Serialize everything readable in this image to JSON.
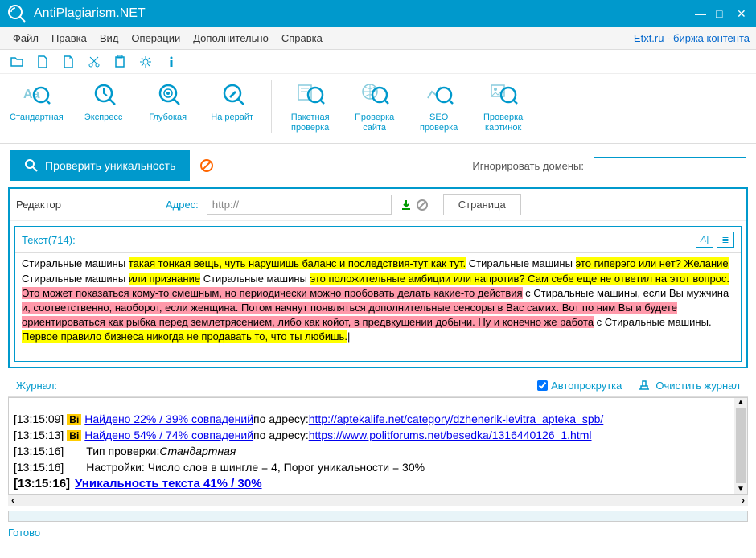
{
  "window": {
    "title": "AntiPlagiarism.NET"
  },
  "menu": {
    "file": "Файл",
    "edit": "Правка",
    "view": "Вид",
    "operations": "Операции",
    "additional": "Дополнительно",
    "help": "Справка",
    "etxt_link": "Etxt.ru - биржа контента"
  },
  "toolbar_big": {
    "standard": "Стандартная",
    "express": "Экспресс",
    "deep": "Глубокая",
    "rewrite": "На рерайт",
    "batch": "Пакетная\nпроверка",
    "site": "Проверка\nсайта",
    "seo": "SEO\nпроверка",
    "images": "Проверка\nкартинок"
  },
  "action": {
    "check_button": "Проверить уникальность",
    "ignore_label": "Игнорировать домены:",
    "ignore_value": ""
  },
  "editor": {
    "label": "Редактор",
    "address_label": "Адрес:",
    "address_value": "http://",
    "page_tab": "Страница",
    "text_count_label": "Текст(714):",
    "content_plain_1": "Стиральные машины ",
    "content_hl_1": "такая тонкая вещь, чуть нарушишь баланс и последствия-тут как тут.",
    "content_plain_2": " Стиральные машины ",
    "content_hl_2": "это гиперэго или нет? Желание",
    "content_plain_3": " Стиральные машины ",
    "content_hl_3": "или признание",
    "content_plain_4": " Стиральные машины ",
    "content_hl_4": "это положительные амбиции или напротив? Сам себе еще не ответил на этот вопрос.",
    "content_pink_1": " Это может показаться кому-то смешным, но периодически можно пробовать делать какие-то действия",
    "content_plain_5": " с Стиральные машины, если Вы мужчина ",
    "content_pink_2": "и, соответственно, наоборот, если женщина. Потом начнут появляться дополнительные сенсоры в Вас самих. Вот по ним Вы и будете ориентироваться как рыбка перед землетрясением, либо как койот, в предвкушении добычи. Ну и конечно же работа",
    "content_plain_6": " с Стиральные машины.",
    "content_hl_5": " Первое правило бизнеса никогда не продавать то, что ты любишь."
  },
  "journal": {
    "label": "Журнал:",
    "autoscroll": "Автопрокрутка",
    "clear": "Очистить журнал",
    "lines": [
      {
        "time": "[13:15:09]",
        "badge": "Bi",
        "link_text": "Найдено 22% / 39% совпадений",
        "mid": " по адресу: ",
        "url": "http://aptekalife.net/category/dzhenerik-levitra_apteka_spb/"
      },
      {
        "time": "[13:15:13]",
        "badge": "Bi",
        "link_text": "Найдено 54% / 74% совпадений",
        "mid": " по адресу: ",
        "url": "https://www.politforums.net/besedka/1316440126_1.html"
      },
      {
        "time": "[13:15:16]",
        "text_pre": "Тип проверки: ",
        "text_italic": "Стандартная"
      },
      {
        "time": "[13:15:16]",
        "text_pre": "Настройки: Число слов в шингле = 4, Порог уникальности = 30%"
      },
      {
        "time": "[13:15:16]",
        "bold_link": "Уникальность текста 41% / 30%"
      }
    ]
  },
  "status": {
    "text": "Готово"
  }
}
